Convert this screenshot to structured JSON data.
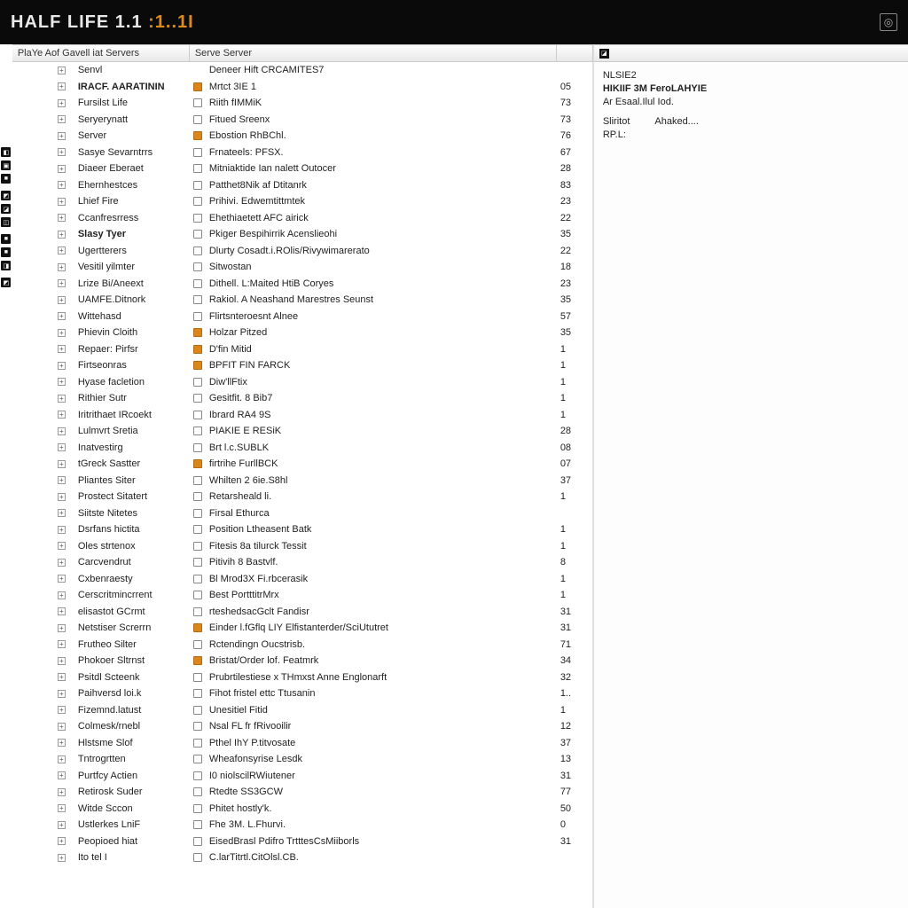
{
  "header": {
    "title_part1": "HALF LIFE 1.1",
    "title_part2": ":1..1I"
  },
  "columns": {
    "col_a": "PlaYe Aof Gavell iat Servers",
    "col_b": "Serve Server",
    "col_c": ""
  },
  "right": {
    "title1": "NLSIE2",
    "title2": "HIKIIF 3M FeroLAHYIE",
    "sub": "Ar Esaal.Ilul Iod.",
    "pair_a": "Sliritot",
    "pair_b": "Ahaked....",
    "last": "RP.L:"
  },
  "sidebar_icons": [
    "◧",
    "▣",
    "■",
    "◩",
    "◪",
    "◫",
    "■",
    "■",
    "◨",
    "◩"
  ],
  "rows": [
    {
      "name": "Senvl",
      "srv": "Deneer Hift CRCAMITES7",
      "n": "",
      "icon": "none"
    },
    {
      "name": "IRACF. AARATININ",
      "srv": "Mrtct 3IE 1",
      "n": "05",
      "icon": "filled",
      "bold": true
    },
    {
      "name": "Fursilst Life",
      "srv": "Riith fIMMiK",
      "n": "73",
      "icon": "outline"
    },
    {
      "name": "Seryerynatt",
      "srv": "Fitued Sreenx",
      "n": "73",
      "icon": "outline"
    },
    {
      "name": "Server",
      "srv": "Ebostion RhBChl.",
      "n": "76",
      "icon": "filled"
    },
    {
      "name": "Sasye Sevarntrrs",
      "srv": "Frnateels: PFSX.",
      "n": "67",
      "icon": "outline"
    },
    {
      "name": "Diaeer Eberaet",
      "srv": "Mitniaktide Ian nalett Outocer",
      "n": "28",
      "icon": "outline"
    },
    {
      "name": "Ehernhestces",
      "srv": "Patthet8Nik af Dtitanrk",
      "n": "83",
      "icon": "outline"
    },
    {
      "name": "Lhief Fire",
      "srv": "Prihivi. Edwemtittmtek",
      "n": "23",
      "icon": "outline"
    },
    {
      "name": "Ccanfresrress",
      "srv": "Ehethiaetett AFC airick",
      "n": "22",
      "icon": "outline"
    },
    {
      "name": "Slasy Tyer",
      "srv": "Pkiger Bespihirrik Acenslieohi",
      "n": "35",
      "icon": "outline",
      "bold": true
    },
    {
      "name": "Ugertterers",
      "srv": "Dlurty Cosadt.i.ROlis/Rivywimarerato",
      "n": "22",
      "icon": "outline"
    },
    {
      "name": "Vesitil yilmter",
      "srv": "Sitwostan",
      "n": "18",
      "icon": "outline"
    },
    {
      "name": "Lrize Bi/Aneext",
      "srv": "Dithell. L:Maited HtiB Coryes",
      "n": "23",
      "icon": "outline"
    },
    {
      "name": "UAMFE.Ditnork",
      "srv": "Rakiol. A Neashand Marestres Seunst",
      "n": "35",
      "icon": "outline"
    },
    {
      "name": "Wittehasd",
      "srv": "Flirtsnteroesnt Alnee",
      "n": "57",
      "icon": "outline"
    },
    {
      "name": "Phievin Cloith",
      "srv": "Holzar Pitzed",
      "n": "35",
      "icon": "filled"
    },
    {
      "name": "Repaer: Pirfsr",
      "srv": "D'fin Mitid",
      "n": "1",
      "icon": "filled2"
    },
    {
      "name": "Firtseonras",
      "srv": "BPFIT FIN FARCK",
      "n": "1",
      "icon": "filled2"
    },
    {
      "name": "Hyase facletion",
      "srv": "Diw'llFtix",
      "n": "1",
      "icon": "outline"
    },
    {
      "name": "Rithier Sutr",
      "srv": "Gesitfit. 8 Bib7",
      "n": "1",
      "icon": "outline"
    },
    {
      "name": "Iritrithaet IRcoekt",
      "srv": "Ibrard RA4 9S",
      "n": "1",
      "icon": "outline"
    },
    {
      "name": "Lulmvrt Sretia",
      "srv": "PIAKIE E RESiK",
      "n": "28",
      "icon": "outline"
    },
    {
      "name": "Inatvestirg",
      "srv": "Brt l.c.SUBLK",
      "n": "08",
      "icon": "outline"
    },
    {
      "name": "tGreck Sastter",
      "srv": "firtrihe FurllBCK",
      "n": "07",
      "icon": "filled2"
    },
    {
      "name": "Pliantes Siter",
      "srv": "Whilten 2 6ie.S8hl",
      "n": "37",
      "icon": "outline"
    },
    {
      "name": "Prostect Sitatert",
      "srv": "Retarsheald li.",
      "n": "1",
      "icon": "outline"
    },
    {
      "name": "Siitste Nitetes",
      "srv": "Firsal Ethurca",
      "n": "",
      "icon": "outline"
    },
    {
      "name": "Dsrfans hictita",
      "srv": "Position Ltheasent Batk",
      "n": "1",
      "icon": "outline"
    },
    {
      "name": "Oles strtenox",
      "srv": "Fitesis 8a tilurck Tessit",
      "n": "1",
      "icon": "outline"
    },
    {
      "name": "Carcvendrut",
      "srv": "Pitivih 8 Bastvlf.",
      "n": "8",
      "icon": "outline"
    },
    {
      "name": "Cxbenraesty",
      "srv": "Bl Mrod3X Fi.rbcerasik",
      "n": "1",
      "icon": "outline"
    },
    {
      "name": "Cerscritmincrrent",
      "srv": "Best PortttitrMrx",
      "n": "1",
      "icon": "outline"
    },
    {
      "name": "elisastot GCrmt",
      "srv": "rteshedsacGclt Fandisr",
      "n": "31",
      "icon": "outline"
    },
    {
      "name": "Netstiser Screrrn",
      "srv": "Einder l.fGflq LIY Elfistanterder/SciUtutret",
      "n": "31",
      "icon": "filled"
    },
    {
      "name": "Frutheo Silter",
      "srv": "Rctendingn Oucstrisb.",
      "n": "71",
      "icon": "outline"
    },
    {
      "name": "Phokoer Sltrnst",
      "srv": "Bristat/Order lof. Featmrk",
      "n": "34",
      "icon": "filled"
    },
    {
      "name": "Psitdl Scteenk",
      "srv": "Prubrtilestiese x THmxst Anne Englonarft",
      "n": "32",
      "icon": "outline"
    },
    {
      "name": "Paihversd loi.k",
      "srv": "Fihot fristel ettc Ttusanin",
      "n": "1..",
      "icon": "outline"
    },
    {
      "name": "Fizemnd.latust",
      "srv": "Unesitiel Fitid",
      "n": "1",
      "icon": "outline"
    },
    {
      "name": "Colmesk/rnebl",
      "srv": "Nsal FL fr fRivooilir",
      "n": "12",
      "icon": "outline"
    },
    {
      "name": "Hlstsme Slof",
      "srv": "Pthel IhY P.titvosate",
      "n": "37",
      "icon": "outline"
    },
    {
      "name": "Tntrogrtten",
      "srv": "Wheafonsyrise Lesdk",
      "n": "13",
      "icon": "outline"
    },
    {
      "name": "Purtfcy Actien",
      "srv": "I0 niolscilRWiutener",
      "n": "31",
      "icon": "outline"
    },
    {
      "name": "Retirosk Suder",
      "srv": "Rtedte SS3GCW",
      "n": "77",
      "icon": "outline"
    },
    {
      "name": "Witde Sccon",
      "srv": "Phitet hostly'k.",
      "n": "50",
      "icon": "outline"
    },
    {
      "name": "Ustlerkes LniF",
      "srv": "Fhe 3M. L.Fhurvi.",
      "n": "0",
      "icon": "outline"
    },
    {
      "name": "Peopioed hiat",
      "srv": "EisedBrasl Pdifro TrtttesCsMiiborls",
      "n": "31",
      "icon": "outline"
    },
    {
      "name": "Ito tel I",
      "srv": "C.larTitrtl.CitOlsl.CB.",
      "n": "",
      "icon": "outline"
    }
  ]
}
